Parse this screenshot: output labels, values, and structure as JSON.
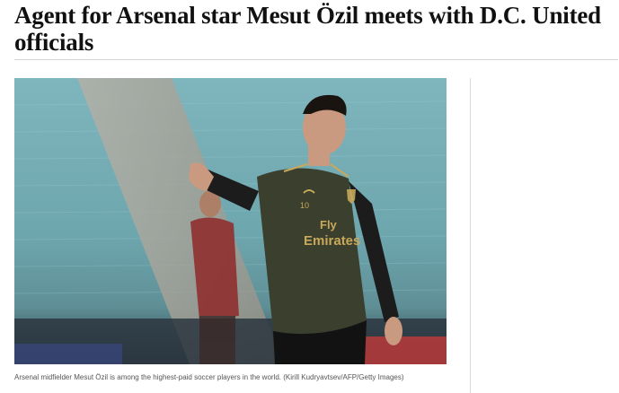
{
  "article": {
    "headline": "Agent for Arsenal star Mesut Özil meets with D.C. United officials",
    "photo": {
      "caption": "Arsenal midfielder Mesut Özil is among the highest-paid soccer players in the world. (Kirill Kudryavtsev/AFP/Getty Images)",
      "shirt_number": "10",
      "sponsor_line1": "Fly",
      "sponsor_line2": "Emirates"
    }
  },
  "colors": {
    "headline": "#111111",
    "caption": "#555555",
    "rule": "#d6d6d6",
    "stadium_seats": "#7fb0b8",
    "jersey": "#3b3f2e",
    "gold_trim": "#c8a85a"
  }
}
